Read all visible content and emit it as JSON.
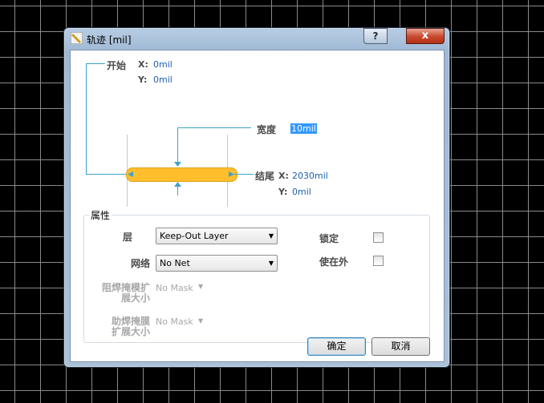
{
  "dialog": {
    "title": "轨迹 [mil]",
    "help_label": "?",
    "close_label": "x"
  },
  "start": {
    "label": "开始",
    "x_label": "X:",
    "x_value": "0mil",
    "y_label": "Y:",
    "y_value": "0mil"
  },
  "width": {
    "label": "宽度",
    "value": "10mil"
  },
  "end": {
    "label": "结尾",
    "x_label": "X:",
    "x_value": "2030mil",
    "y_label": "Y:",
    "y_value": "0mil"
  },
  "properties": {
    "legend": "属性",
    "layer_label": "层",
    "layer_value": "Keep-Out Layer",
    "net_label": "网络",
    "net_value": "No Net",
    "solder_mask_label": "阻焊掩模扩展大小",
    "solder_mask_value": "No Mask",
    "paste_mask_label": "助焊掩膜扩展大小",
    "paste_mask_value": "No Mask",
    "locked_label": "锁定",
    "keepout_label": "使在外",
    "locked_checked": false,
    "keepout_checked": false
  },
  "buttons": {
    "ok": "确定",
    "cancel": "取消"
  }
}
